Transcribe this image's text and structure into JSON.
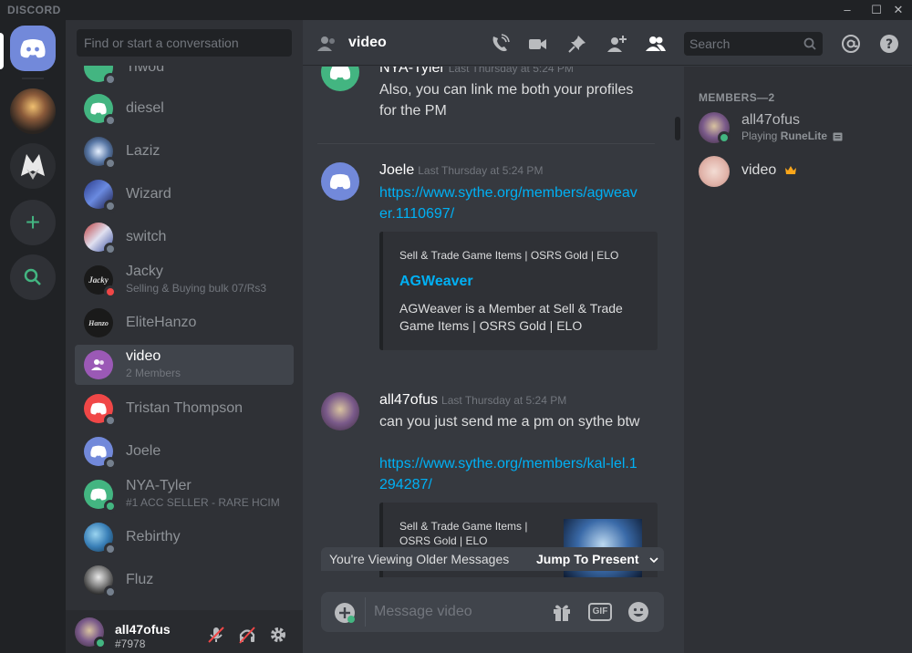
{
  "titlebar": {
    "brand": "DISCORD",
    "minimize": "–",
    "maximize": "☐",
    "close": "✕"
  },
  "dm_sidebar": {
    "search_placeholder": "Find or start a conversation",
    "items": [
      {
        "name": "Tiwod",
        "status": "offline"
      },
      {
        "name": "diesel",
        "status": "offline"
      },
      {
        "name": "Laziz",
        "status": "offline"
      },
      {
        "name": "Wizard",
        "status": "offline"
      },
      {
        "name": "switch",
        "status": "offline"
      },
      {
        "name": "Jacky",
        "sub": "Selling & Buying bulk 07/Rs3",
        "status": "dnd"
      },
      {
        "name": "EliteHanzo",
        "status": "none"
      },
      {
        "name": "video",
        "sub": "2 Members",
        "status": "group"
      },
      {
        "name": "Tristan Thompson",
        "status": "offline"
      },
      {
        "name": "Joele",
        "status": "offline"
      },
      {
        "name": "NYA-Tyler",
        "sub": "#1 ACC SELLER - RARE HCIM",
        "status": "online"
      },
      {
        "name": "Rebirthy",
        "status": "offline"
      },
      {
        "name": "Fluz",
        "status": "offline"
      }
    ],
    "user": {
      "name": "all47ofus",
      "tag": "#7978"
    }
  },
  "header": {
    "channel": "video",
    "search_placeholder": "Search"
  },
  "messages": [
    {
      "author": "NYA-Tyler",
      "time": "Last Thursday at 5:24 PM",
      "text": "Also, you can link me both your profiles for the PM"
    },
    {
      "author": "Joele",
      "time": "Last Thursday at 5:24 PM",
      "link": "https://www.sythe.org/members/agweaver.1110697/",
      "embed": {
        "provider": "Sell & Trade Game Items | OSRS Gold | ELO",
        "title": "AGWeaver",
        "description": "AGWeaver is a Member at Sell & Trade Game Items | OSRS Gold | ELO"
      }
    },
    {
      "author": "all47ofus",
      "time": "Last Thursday at 5:24 PM",
      "text": "can you just send me a pm on sythe btw",
      "link": "https://www.sythe.org/members/kal-lel.1294287/",
      "embed": {
        "provider": "Sell & Trade Game Items | OSRS Gold | ELO"
      }
    }
  ],
  "older_bar": {
    "label": "You're Viewing Older Messages",
    "jump": "Jump To Present"
  },
  "composer": {
    "placeholder": "Message video",
    "gif": "GIF"
  },
  "members": {
    "heading": "MEMBERS—2",
    "list": [
      {
        "name": "all47ofus",
        "activity_prefix": "Playing",
        "activity": "RuneLite",
        "status": "online"
      },
      {
        "name": "video",
        "owner": true
      }
    ]
  },
  "colors": {
    "blurple": "#7289da",
    "online": "#43b581",
    "dnd": "#f04747",
    "link": "#00b0f4",
    "crown": "#faa61a"
  }
}
